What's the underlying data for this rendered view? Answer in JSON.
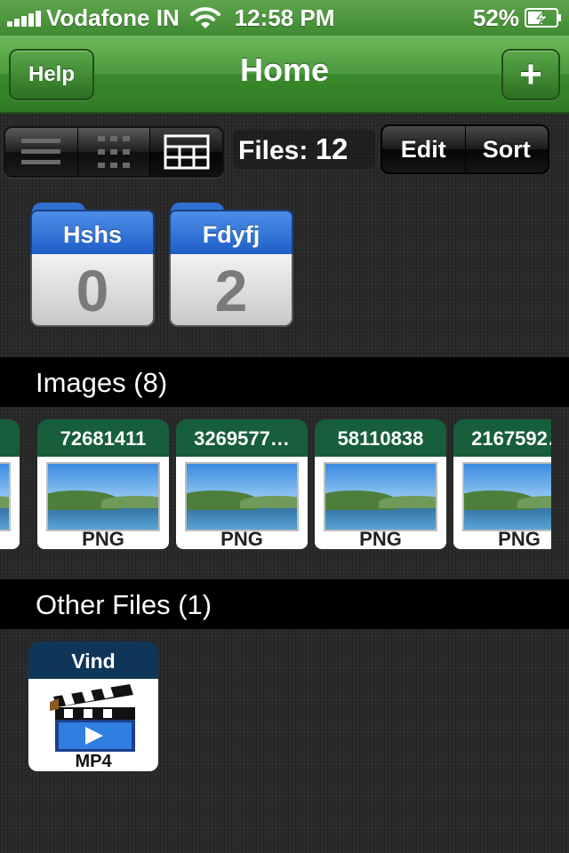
{
  "status_bar": {
    "carrier": "Vodafone IN",
    "time": "12:58 PM",
    "battery": "52%"
  },
  "nav": {
    "help_label": "Help",
    "title": "Home",
    "add_label": "+"
  },
  "toolbar": {
    "view_modes": [
      "list-view-icon",
      "grid-view-icon",
      "table-view-icon"
    ],
    "active_view": "table-view-icon",
    "files_label": "Files:",
    "files_count": "12",
    "edit_label": "Edit",
    "sort_label": "Sort"
  },
  "folders": [
    {
      "name": "Hshs",
      "count": "0"
    },
    {
      "name": "Fdyfj",
      "count": "2"
    }
  ],
  "images_section": {
    "header": "Images (8)",
    "items": [
      {
        "name": "72681411",
        "type": "PNG"
      },
      {
        "name": "3269577…",
        "type": "PNG"
      },
      {
        "name": "58110838",
        "type": "PNG"
      },
      {
        "name": "2167592…",
        "type": "PNG"
      }
    ]
  },
  "other_section": {
    "header": "Other Files (1)",
    "items": [
      {
        "name": "Vind",
        "type": "MP4"
      }
    ]
  },
  "colors": {
    "nav_green": "#4c9a3d",
    "folder_blue": "#2f6fd0",
    "image_tab_green": "#175e3a",
    "video_tab_navy": "#0f3658"
  }
}
